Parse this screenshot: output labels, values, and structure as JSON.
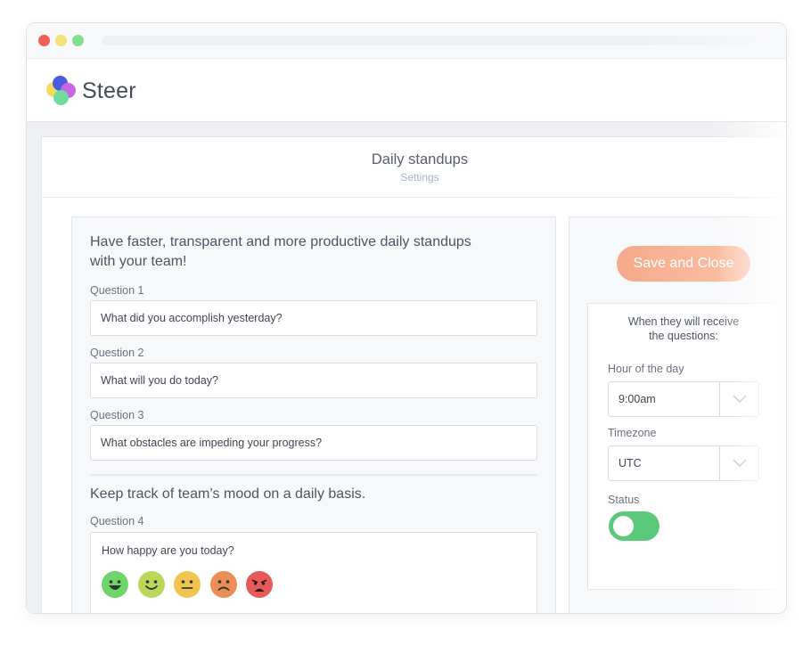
{
  "app": {
    "name": "Steer"
  },
  "page": {
    "title": "Daily standups",
    "subtitle": "Settings"
  },
  "questions": {
    "intro": "Have faster, transparent and more productive daily standups with your team!",
    "items": [
      {
        "label": "Question 1",
        "value": "What did you accomplish yesterday?"
      },
      {
        "label": "Question 2",
        "value": "What will you do today?"
      },
      {
        "label": "Question 3",
        "value": "What obstacles are impeding your progress?"
      }
    ]
  },
  "mood": {
    "title": "Keep track of team’s mood on a daily basis.",
    "label": "Question 4",
    "question": "How happy are you today?",
    "options": [
      {
        "icon": "very-happy-face-icon",
        "color": "#6fd46a"
      },
      {
        "icon": "happy-face-icon",
        "color": "#b9d85a"
      },
      {
        "icon": "neutral-face-icon",
        "color": "#f3c44d"
      },
      {
        "icon": "sad-face-icon",
        "color": "#ec8d55"
      },
      {
        "icon": "very-sad-face-icon",
        "color": "#e85a5a"
      }
    ]
  },
  "actions": {
    "save_label": "Save and Close"
  },
  "schedule": {
    "title": "When they will receive the questions:",
    "hour_label": "Hour of the day",
    "hour_value": "9:00am",
    "timezone_label": "Timezone",
    "timezone_value": "UTC",
    "status_label": "Status",
    "status_on": true
  },
  "colors": {
    "accent": "#f6a98a",
    "toggle_on": "#5bc87a"
  }
}
